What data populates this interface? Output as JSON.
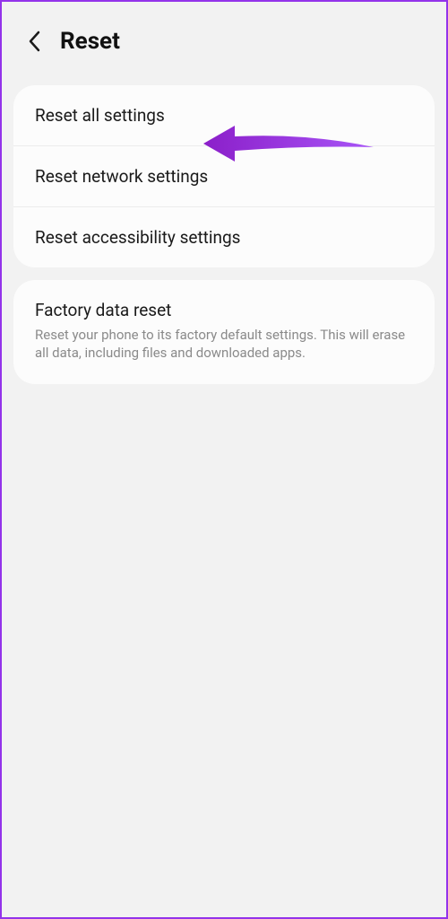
{
  "header": {
    "title": "Reset"
  },
  "group1": {
    "items": [
      {
        "label": "Reset all settings"
      },
      {
        "label": "Reset network settings"
      },
      {
        "label": "Reset accessibility settings"
      }
    ]
  },
  "group2": {
    "title": "Factory data reset",
    "description": "Reset your phone to its factory default settings. This will erase all data, including files and downloaded apps."
  },
  "annotation": {
    "color": "#8b1fc9"
  }
}
